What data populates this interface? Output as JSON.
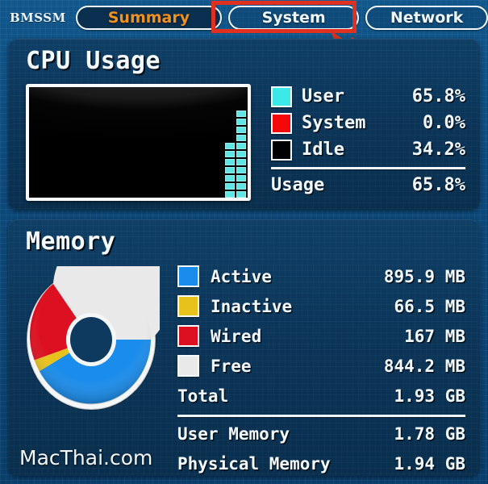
{
  "header": {
    "brand": "BMSSM",
    "tabs": [
      {
        "label": "Summary",
        "active": true
      },
      {
        "label": "System",
        "active": false
      },
      {
        "label": "Network",
        "active": false
      }
    ],
    "annotation": {
      "highlight_target": "System",
      "box_color": "#e03020",
      "arrow_color": "#d5341f"
    }
  },
  "cpu": {
    "title": "CPU Usage",
    "legend": [
      {
        "name": "User",
        "value": "65.8%",
        "color": "#3ce8e8"
      },
      {
        "name": "System",
        "value": "0.0%",
        "color": "#f5080a"
      },
      {
        "name": "Idle",
        "value": "34.2%",
        "color": "#000000"
      }
    ],
    "summary": {
      "label": "Usage",
      "value": "65.8%"
    },
    "graph": {
      "led_color": "#5fe6e4",
      "background": "#000000",
      "bar_heights": [
        7,
        11
      ]
    }
  },
  "memory": {
    "title": "Memory",
    "legend": [
      {
        "name": "Active",
        "value": "895.9 MB",
        "color": "#1a8ceb"
      },
      {
        "name": "Inactive",
        "value": "66.5 MB",
        "color": "#e8c21c"
      },
      {
        "name": "Wired",
        "value": "167 MB",
        "color": "#dc1020"
      },
      {
        "name": "Free",
        "value": "844.2 MB",
        "color": "#e9e9e9"
      }
    ],
    "total": {
      "label": "Total",
      "value": "1.93 GB"
    },
    "footer": [
      {
        "label": "User Memory",
        "value": "1.78 GB"
      },
      {
        "label": "Physical Memory",
        "value": "1.94 GB"
      }
    ]
  },
  "chart_data": {
    "type": "pie",
    "title": "Memory",
    "categories": [
      "Active",
      "Inactive",
      "Wired",
      "Free"
    ],
    "values": [
      895.9,
      66.5,
      167,
      844.2
    ],
    "unit": "MB",
    "colors": [
      "#1a8ceb",
      "#e8c21c",
      "#dc1020",
      "#e9e9e9"
    ],
    "total": 1973.6,
    "legend": "right",
    "donut": true
  },
  "watermark": "MacThai.com"
}
